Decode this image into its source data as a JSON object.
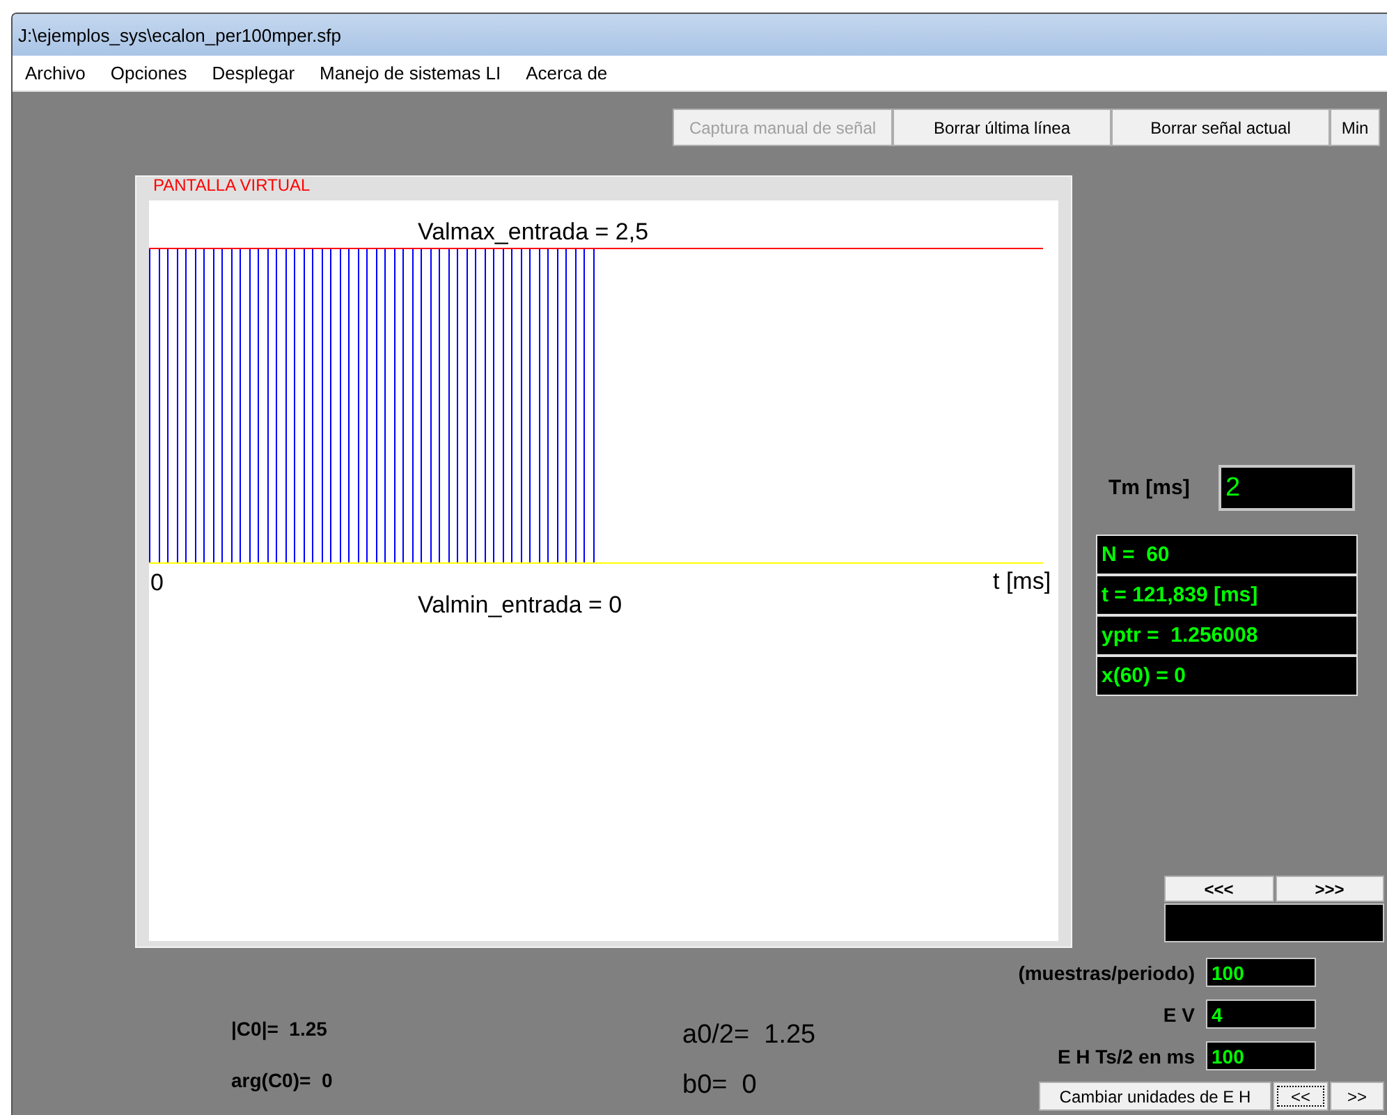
{
  "window": {
    "title": "J:\\ejemplos_sys\\ecalon_per100mper.sfp"
  },
  "menu": [
    "Archivo",
    "Opciones",
    "Desplegar",
    "Manejo de sistemas LI",
    "Acerca de"
  ],
  "toolbar": [
    {
      "label": "Captura manual de señal",
      "disabled": true
    },
    {
      "label": "Borrar última línea",
      "disabled": false
    },
    {
      "label": "Borrar señal actual",
      "disabled": false
    },
    {
      "label": "Min",
      "disabled": false
    }
  ],
  "panel": {
    "title": "PANTALLA VIRTUAL",
    "max_label": "Valmax_entrada = 2,5",
    "min_label": "Valmin_entrada = 0",
    "origin_label": "0",
    "axis_label": "t [ms]"
  },
  "tm": {
    "label": "Tm [ms]",
    "value": "2"
  },
  "readouts": [
    "N =  60",
    "t = 121,839 [ms]",
    "yptr =  1.256008",
    "x(60) = 0"
  ],
  "nav_buttons": [
    "<<<",
    ">>>"
  ],
  "fields": [
    {
      "label": "(muestras/periodo)",
      "value": "100"
    },
    {
      "label": "E V",
      "value": "4"
    },
    {
      "label": "E H Ts/2 en ms",
      "value": "100"
    }
  ],
  "bottom_buttons": [
    {
      "label": "Cambiar unidades de E H",
      "focused": false
    },
    {
      "label": "<<",
      "focused": true
    },
    {
      "label": ">>",
      "focused": false
    }
  ],
  "magnitude_lines": [
    "|C0|=  1.25",
    "arg(C0)=  0"
  ],
  "coefficient_lines": [
    "a0/2=  1.25",
    "b0=  0"
  ]
}
